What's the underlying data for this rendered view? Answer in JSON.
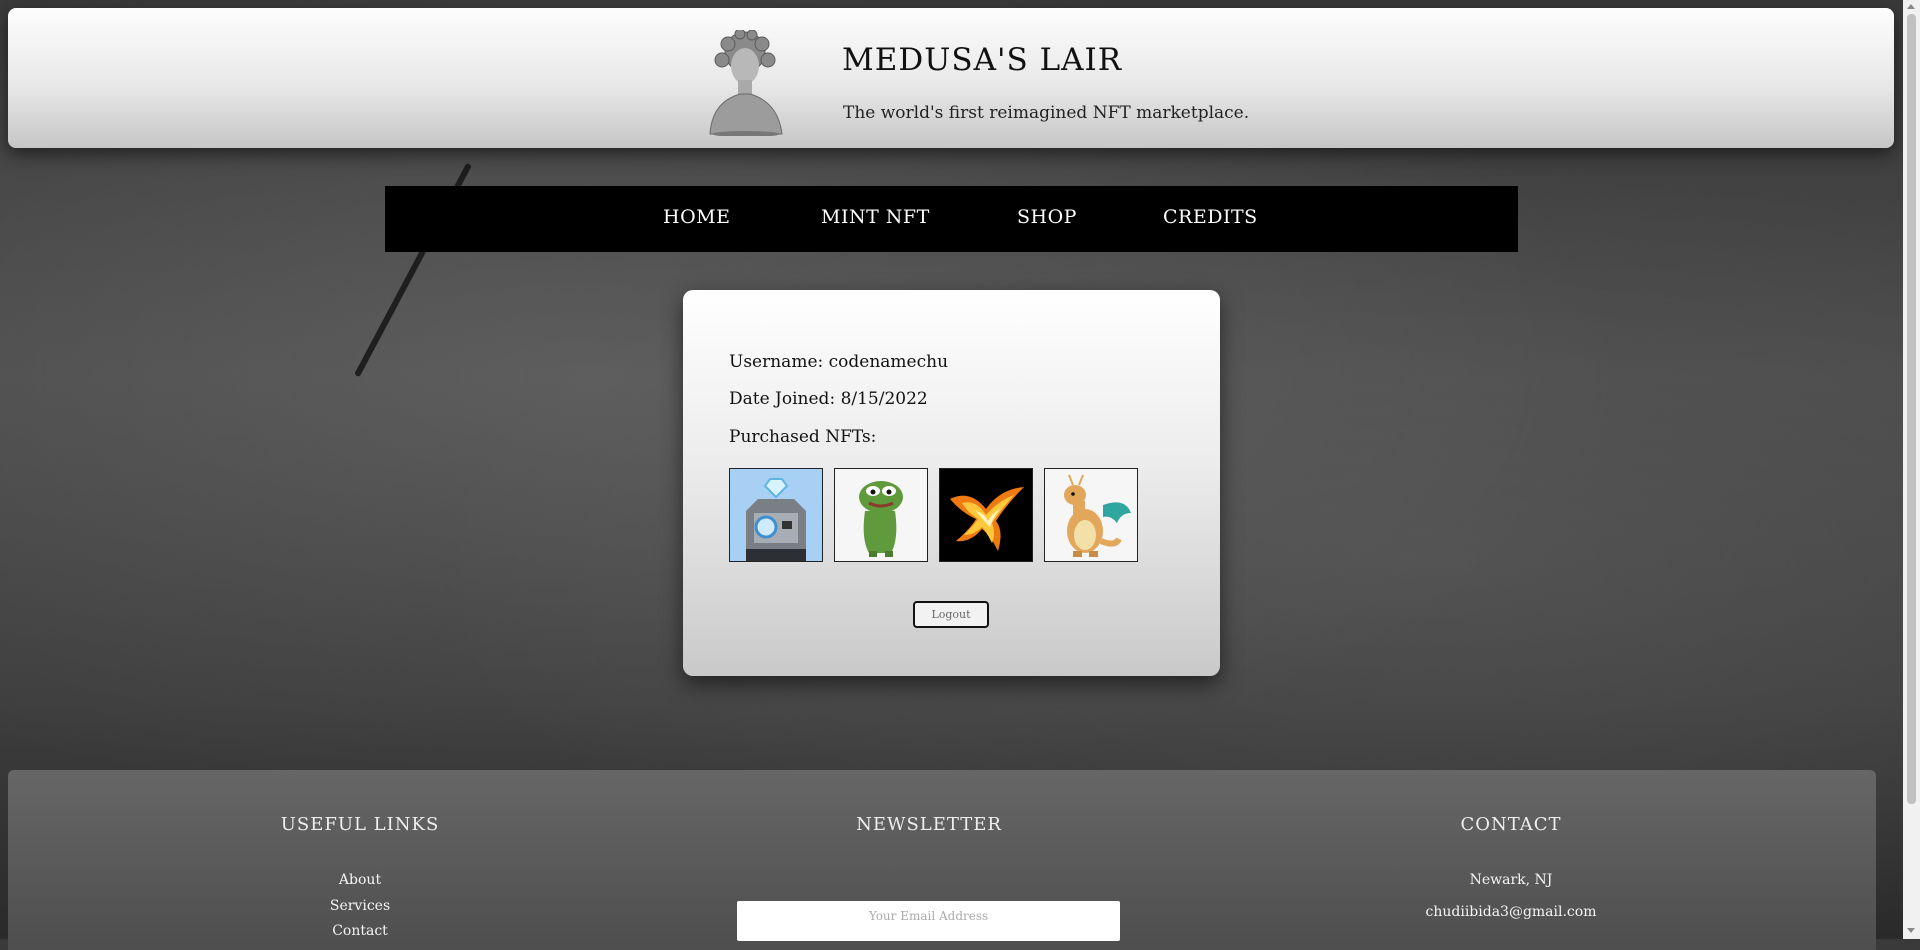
{
  "header": {
    "title": "MEDUSA'S LAIR",
    "tagline": "The world's first reimagined NFT marketplace."
  },
  "nav": {
    "items": [
      {
        "label": "HOME"
      },
      {
        "label": "MINT NFT"
      },
      {
        "label": "SHOP"
      },
      {
        "label": "CREDITS"
      }
    ]
  },
  "profile": {
    "username_line": "Username: codenamechu",
    "date_joined_line": "Date Joined: 8/15/2022",
    "purchased_label": "Purchased NFTs:",
    "nfts": [
      {
        "name": "diamond-robot-cat-nft"
      },
      {
        "name": "pepe-frog-nft"
      },
      {
        "name": "fire-phoenix-nft"
      },
      {
        "name": "dragonite-nft"
      }
    ],
    "logout_label": "Logout"
  },
  "footer": {
    "useful_links": {
      "title": "USEFUL LINKS",
      "links": [
        "About",
        "Services",
        "Contact"
      ]
    },
    "newsletter": {
      "title": "NEWSLETTER",
      "placeholder": "Your Email Address"
    },
    "contact": {
      "title": "CONTACT",
      "location": "Newark, NJ",
      "email": "chudiibida3@gmail.com"
    }
  }
}
